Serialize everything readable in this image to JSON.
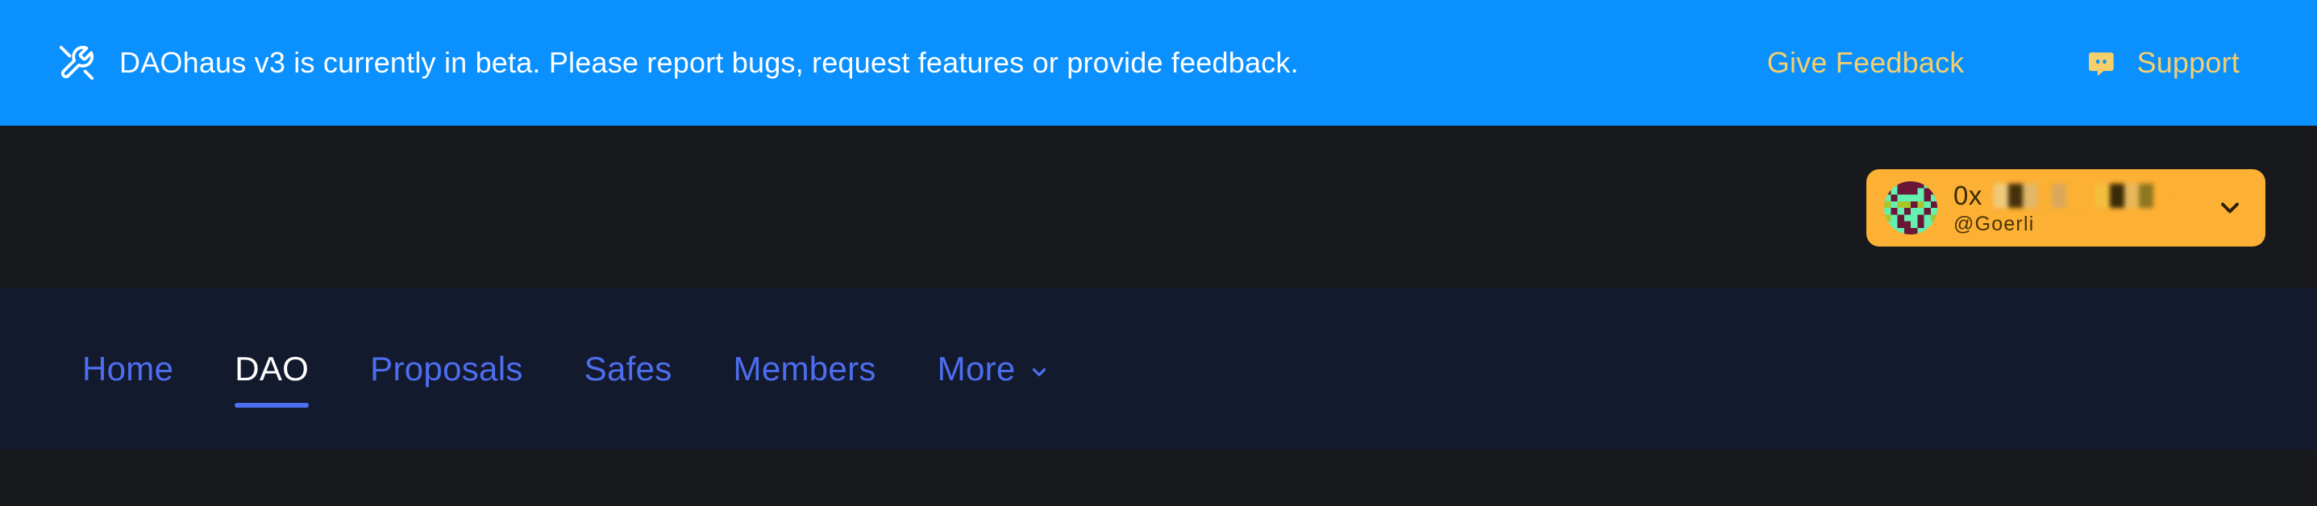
{
  "banner": {
    "icon": "tools-icon",
    "message": "DAOhaus v3 is currently in beta. Please report bugs, request features or provide feedback.",
    "feedback_label": "Give Feedback",
    "support_label": "Support",
    "support_icon": "discord-icon",
    "background_color": "#0a90ff",
    "text_color": "#ffffff",
    "link_color": "#f5cf6a"
  },
  "header": {
    "wallet": {
      "avatar": "blockie-avatar",
      "address_prefix": "0x",
      "address_redacted": true,
      "network": "@Goerli",
      "chevron_icon": "chevron-down-icon",
      "background_color": "#fcb034",
      "text_color": "#3b2a08"
    },
    "background_color": "#17191c"
  },
  "nav": {
    "background_color": "#141a2e",
    "link_color": "#4d6ef0",
    "active_color": "#ffffff",
    "active_underline_color": "#4d6ef0",
    "items": [
      {
        "label": "Home",
        "active": false,
        "has_chevron": false
      },
      {
        "label": "DAO",
        "active": true,
        "has_chevron": false
      },
      {
        "label": "Proposals",
        "active": false,
        "has_chevron": false
      },
      {
        "label": "Safes",
        "active": false,
        "has_chevron": false
      },
      {
        "label": "Members",
        "active": false,
        "has_chevron": false
      },
      {
        "label": "More",
        "active": false,
        "has_chevron": true
      }
    ]
  },
  "body": {
    "background_color": "#17191c"
  }
}
